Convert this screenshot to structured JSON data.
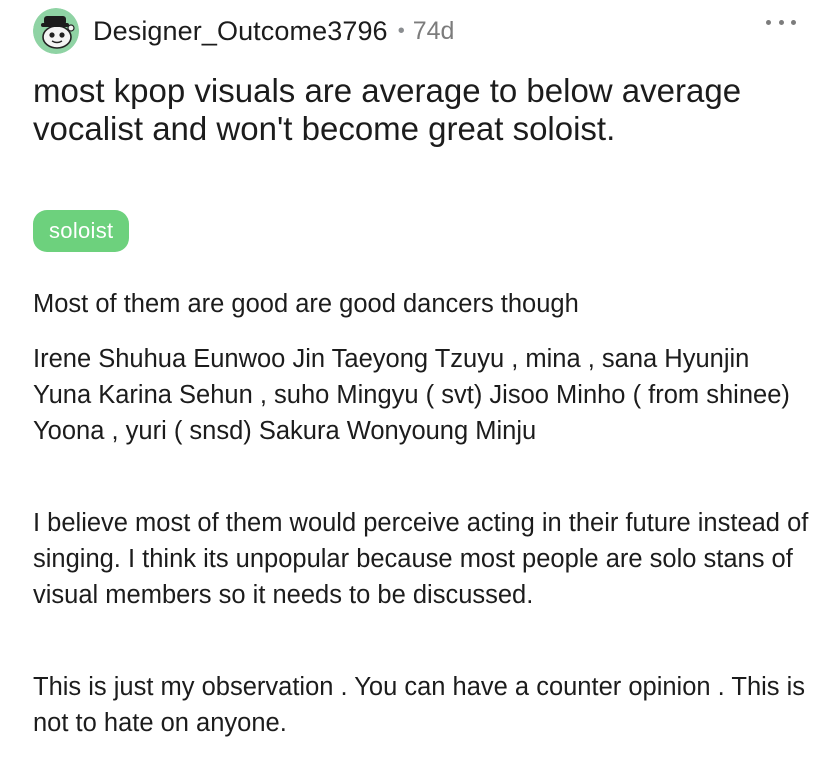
{
  "post": {
    "author": "Designer_Outcome3796",
    "separator": "•",
    "age": "74d",
    "more_label": "...",
    "title": "most kpop visuals are average to below average vocalist and won't become great soloist.",
    "flair": "soloist",
    "paragraphs": [
      "Most of them are good are good dancers though",
      "Irene Shuhua Eunwoo Jin Taeyong Tzuyu , mina , sana Hyunjin Yuna Karina Sehun , suho Mingyu ( svt) Jisoo Minho ( from shinee) Yoona , yuri ( snsd) Sakura Wonyoung Minju",
      "I believe most of them would perceive acting in their future instead of singing. I think its unpopular because most people are solo stans of visual members so it needs to be discussed.",
      "This is just my observation . You can have a counter opinion . This is not to hate on anyone."
    ]
  },
  "icons": {
    "avatar": "snoo-avatar-icon",
    "more": "more-options-icon"
  },
  "colors": {
    "flair_background": "#6dd17d",
    "text": "#1c1c1c",
    "meta": "#7c7c7c",
    "avatar_background": "#8fd3a4"
  }
}
